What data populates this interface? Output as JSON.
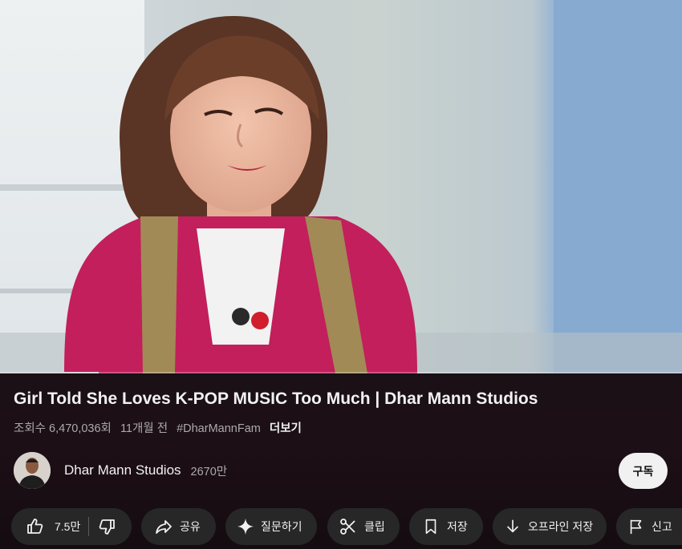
{
  "video": {
    "progress_fraction": 0.145
  },
  "title": "Girl Told She Loves K-POP MUSIC Too Much | Dhar Mann Studios",
  "meta": {
    "views": "조회수 6,470,036회",
    "date": "11개월 전",
    "hashtag": "#DharMannFam",
    "more": "더보기"
  },
  "channel": {
    "name": "Dhar Mann Studios",
    "subscribers": "2670만",
    "subscribe_label": "구독"
  },
  "actions": {
    "like_count": "7.5만",
    "share": "공유",
    "ask": "질문하기",
    "clip": "클립",
    "save": "저장",
    "download": "오프라인 저장",
    "report": "신고"
  },
  "colors": {
    "background": "#0f0f0f",
    "pill": "#272727",
    "text": "#f1f1f1",
    "secondary": "#aaaaaa"
  }
}
